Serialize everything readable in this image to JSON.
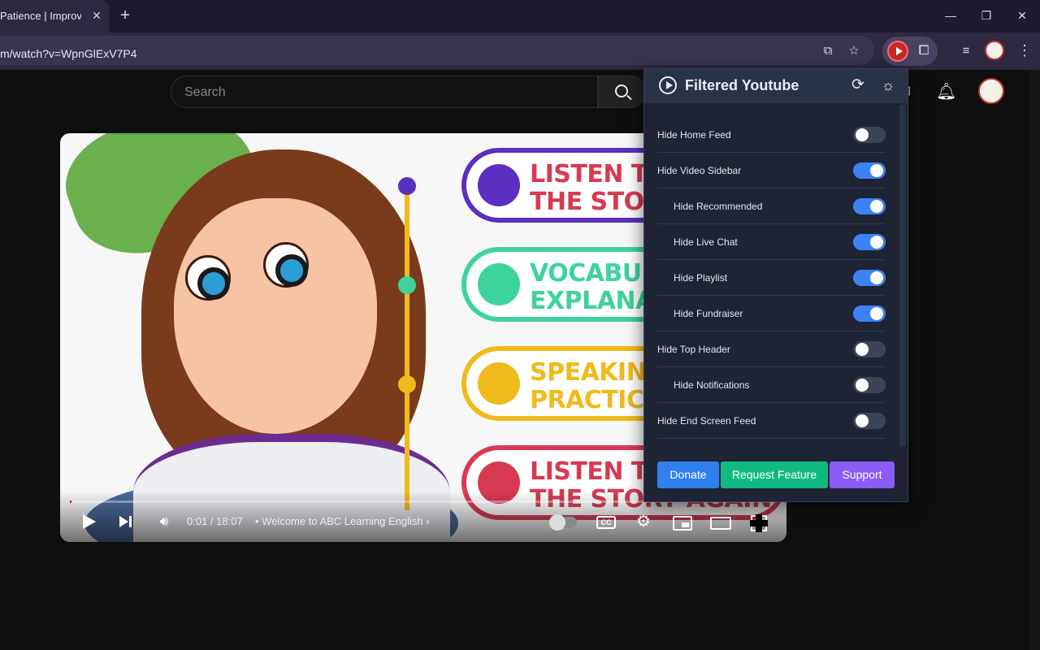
{
  "browser": {
    "tab_title": "Patience | Improve",
    "tab_close_glyph": "✕",
    "new_tab_glyph": "+",
    "url": "m/watch?v=WpnGlExV7P4",
    "window_controls": {
      "minimize": "—",
      "restore": "❐",
      "close": "✕"
    },
    "icons": [
      "install-app-icon",
      "bookmark-star-icon",
      "filtered-youtube-extension-icon",
      "extensions-puzzle-icon",
      "media-queue-icon",
      "profile-avatar",
      "menu-kebab-icon"
    ]
  },
  "youtube": {
    "search_placeholder": "Search",
    "icons": [
      "search-icon",
      "create-icon",
      "notifications-bell-icon",
      "account-avatar"
    ]
  },
  "player": {
    "thumbnail_steps": [
      {
        "text": "LISTEN TO\nTHE STORY",
        "color": "#5b2fbf",
        "accent": "#d83a52"
      },
      {
        "text": "VOCABULARY\nEXPLANATION",
        "color": "#3ed39a",
        "accent": "#3ed39a"
      },
      {
        "text": "SPEAKING\nPRACTICE",
        "color": "#f1b91b",
        "accent": "#f1b91b"
      },
      {
        "text": "LISTEN TO\nTHE STORY AGAIN",
        "color": "#d83a52",
        "accent": "#d83a52"
      }
    ],
    "current_time": "0:01 / 18:07",
    "chapter": "• Welcome to ABC Learning English ›",
    "progress": 0.001,
    "cc_label": "CC"
  },
  "popup": {
    "title": "Filtered Youtube",
    "options": [
      {
        "label": "Hide Home Feed",
        "level": 0,
        "enabled": false
      },
      {
        "label": "Hide Video Sidebar",
        "level": 0,
        "enabled": true
      },
      {
        "label": "Hide Recommended",
        "level": 1,
        "enabled": true
      },
      {
        "label": "Hide Live Chat",
        "level": 1,
        "enabled": true
      },
      {
        "label": "Hide Playlist",
        "level": 1,
        "enabled": true
      },
      {
        "label": "Hide Fundraiser",
        "level": 1,
        "enabled": true
      },
      {
        "label": "Hide Top Header",
        "level": 0,
        "enabled": false
      },
      {
        "label": "Hide Notifications",
        "level": 1,
        "enabled": false
      },
      {
        "label": "Hide End Screen Feed",
        "level": 0,
        "enabled": false
      }
    ],
    "footer": {
      "donate": "Donate",
      "request_feature": "Request Feature",
      "support": "Support"
    },
    "colors": {
      "accent_on": "#3b82f6",
      "donate": "#2f80ed",
      "request": "#10b981",
      "support": "#8b5cf6"
    }
  }
}
